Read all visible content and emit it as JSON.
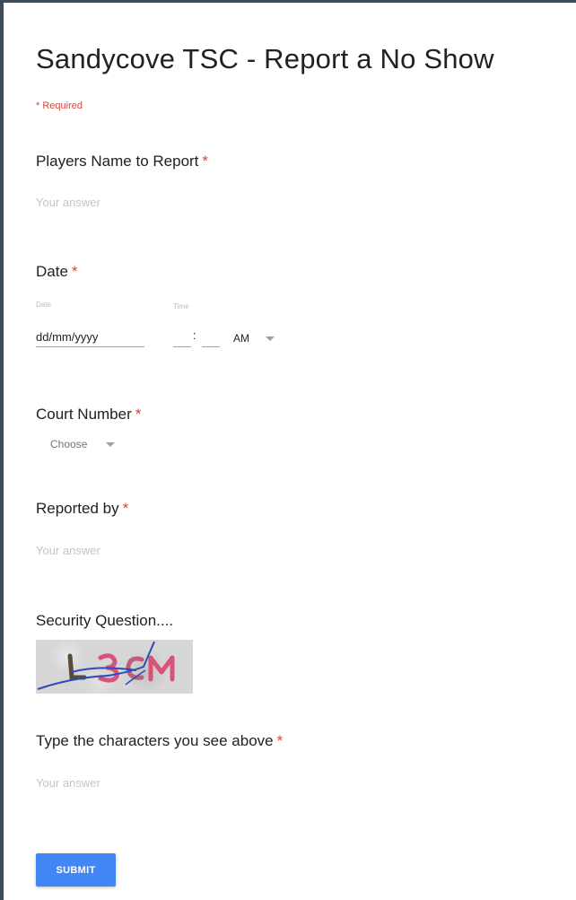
{
  "form": {
    "title": "Sandycove TSC - Report a No Show",
    "required_note": "* Required",
    "submit_label": "SUBMIT"
  },
  "questions": {
    "players_name": {
      "label": "Players Name to Report",
      "placeholder": "Your answer"
    },
    "date": {
      "label": "Date",
      "date_sublabel": "Date",
      "time_sublabel": "Time",
      "date_placeholder": "dd/mm/yyyy",
      "time_separator": ":",
      "ampm_value": "AM"
    },
    "court_number": {
      "label": "Court Number",
      "selected": "Choose"
    },
    "reported_by": {
      "label": "Reported by",
      "placeholder": "Your answer"
    },
    "security": {
      "label": "Security Question....",
      "captcha_text": "L3CM"
    },
    "captcha_answer": {
      "label": "Type the characters you see above",
      "placeholder": "Your answer"
    }
  },
  "required_marker": "*",
  "colors": {
    "accent": "#4285f4",
    "required": "#db4437",
    "frame_border": "#3d4a57",
    "captcha_pink": "#d9527a",
    "captcha_line": "#2b4bb8"
  },
  "icons": {
    "dropdown": "chevron-down-icon"
  }
}
